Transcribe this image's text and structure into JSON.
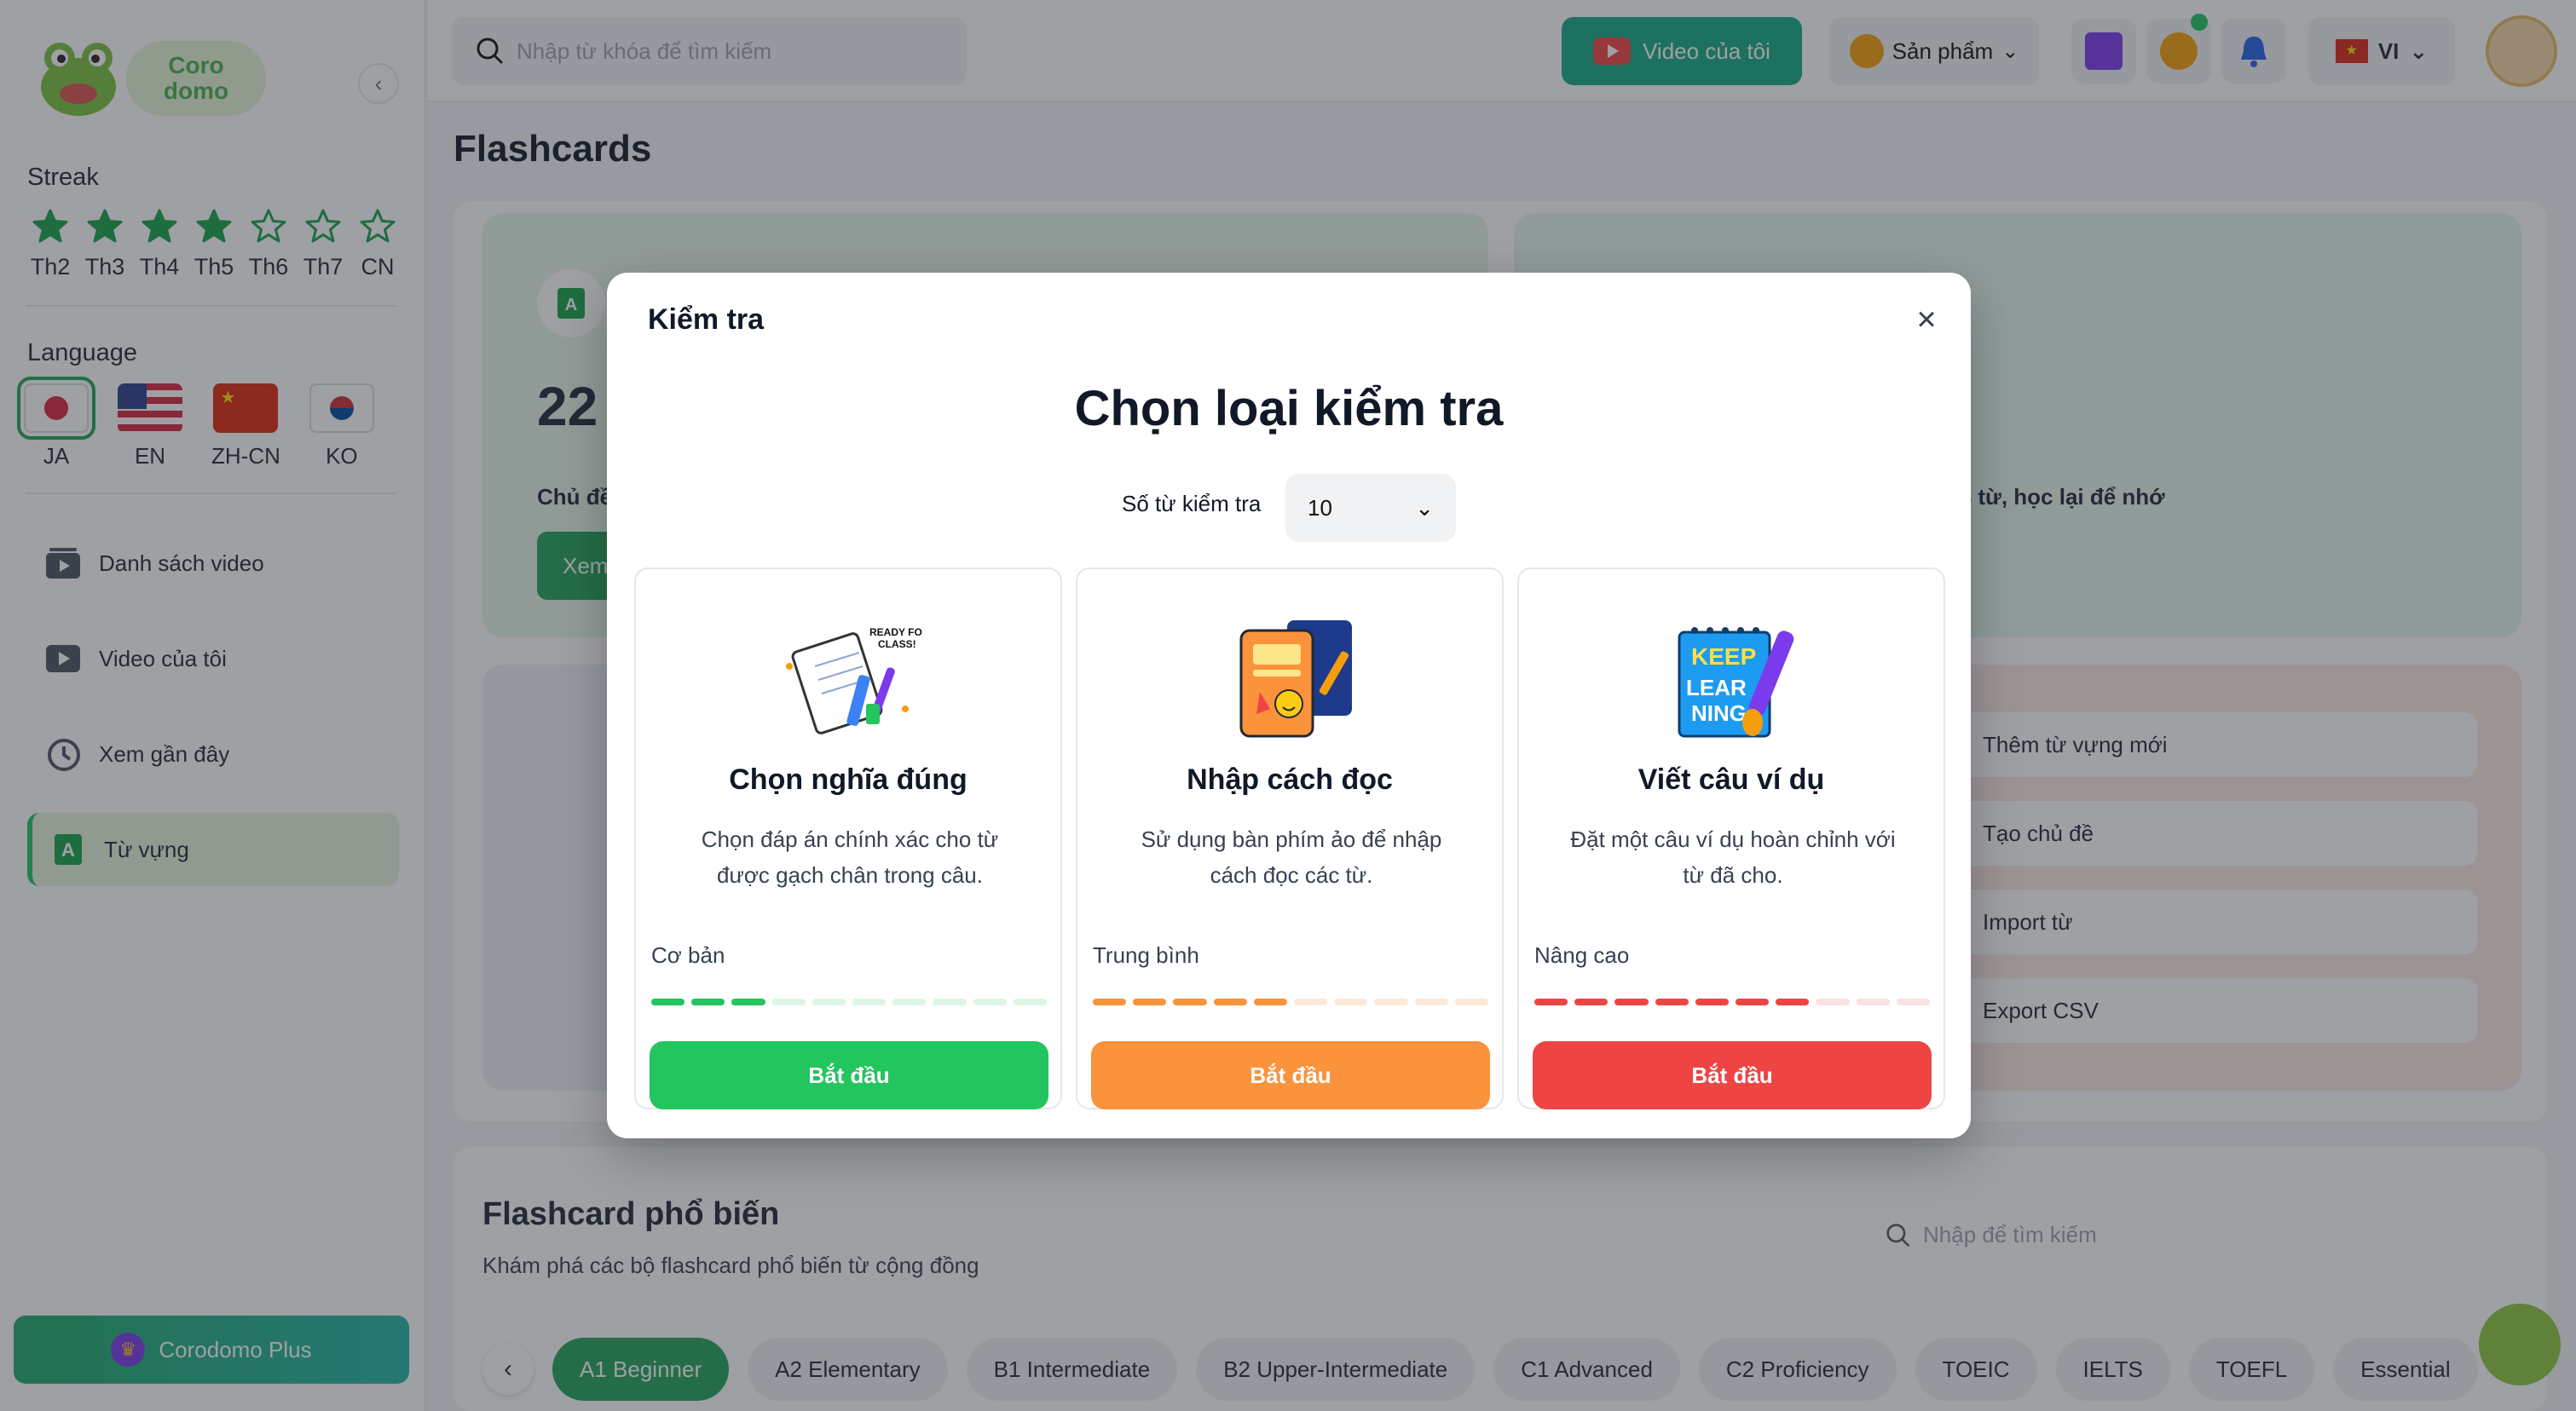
{
  "logo": {
    "text_line1": "Coro",
    "text_line2": "domo"
  },
  "sidebar": {
    "streak_title": "Streak",
    "streak_days": [
      {
        "label": "Th2",
        "done": true
      },
      {
        "label": "Th3",
        "done": true
      },
      {
        "label": "Th4",
        "done": true
      },
      {
        "label": "Th5",
        "done": true
      },
      {
        "label": "Th6",
        "done": false
      },
      {
        "label": "Th7",
        "done": false
      },
      {
        "label": "CN",
        "done": false
      }
    ],
    "language_title": "Language",
    "languages": [
      {
        "code": "JA",
        "active": true
      },
      {
        "code": "EN",
        "active": false
      },
      {
        "code": "ZH-CN",
        "active": false
      },
      {
        "code": "KO",
        "active": false
      }
    ],
    "nav": [
      {
        "label": "Danh sách video",
        "icon": "video-list-icon"
      },
      {
        "label": "Video của tôi",
        "icon": "play-icon"
      },
      {
        "label": "Xem gần đây",
        "icon": "history-icon"
      },
      {
        "label": "Từ vựng",
        "icon": "vocabulary-icon",
        "active": true
      }
    ],
    "plus_label": "Corodomo Plus"
  },
  "topbar": {
    "search_placeholder": "Nhập từ khóa để tìm kiếm",
    "video_btn": "Video của tôi",
    "product_btn": "Sản phẩm",
    "language": "VI"
  },
  "page": {
    "title": "Flashcards",
    "stat_number": "22",
    "stat_label": "Chủ đề",
    "stat_button": "Xem",
    "tip_text": "% từ, học lại để nhớ",
    "actions": [
      "Thêm từ vựng mới",
      "Tạo chủ đề",
      "Import từ",
      "Export CSV"
    ]
  },
  "popular": {
    "title": "Flashcard phổ biến",
    "subtitle": "Khám phá các bộ flashcard phổ biến từ cộng đồng",
    "search_placeholder": "Nhập để tìm kiếm",
    "levels": [
      "A1 Beginner",
      "A2 Elementary",
      "B1 Intermediate",
      "B2 Upper-Intermediate",
      "C1 Advanced",
      "C2 Proficiency",
      "TOEIC",
      "IELTS",
      "TOEFL",
      "Essential"
    ],
    "active_level": "A1 Beginner"
  },
  "modal": {
    "title": "Kiểm tra",
    "heading": "Chọn loại kiểm tra",
    "count_label": "Số từ kiểm tra",
    "count_value": "10",
    "cards": [
      {
        "name": "Chọn nghĩa đúng",
        "desc": "Chọn đáp án chính xác cho từ được gạch chân trong câu.",
        "level": "Cơ bản",
        "filled": 3,
        "total": 10,
        "color": "#22c55e",
        "light": "#dcf5e4",
        "button": "Bắt đầu"
      },
      {
        "name": "Nhập cách đọc",
        "desc": "Sử dụng bàn phím ảo để nhập cách đọc các từ.",
        "level": "Trung bình",
        "filled": 5,
        "total": 10,
        "color": "#fb923c",
        "light": "#fde9da",
        "button": "Bắt đầu"
      },
      {
        "name": "Viết câu ví dụ",
        "desc": "Đặt một câu ví dụ hoàn chỉnh với từ đã cho.",
        "level": "Nâng cao",
        "filled": 7,
        "total": 10,
        "color": "#ef4444",
        "light": "#fbe1e1",
        "button": "Bắt đầu"
      }
    ]
  }
}
